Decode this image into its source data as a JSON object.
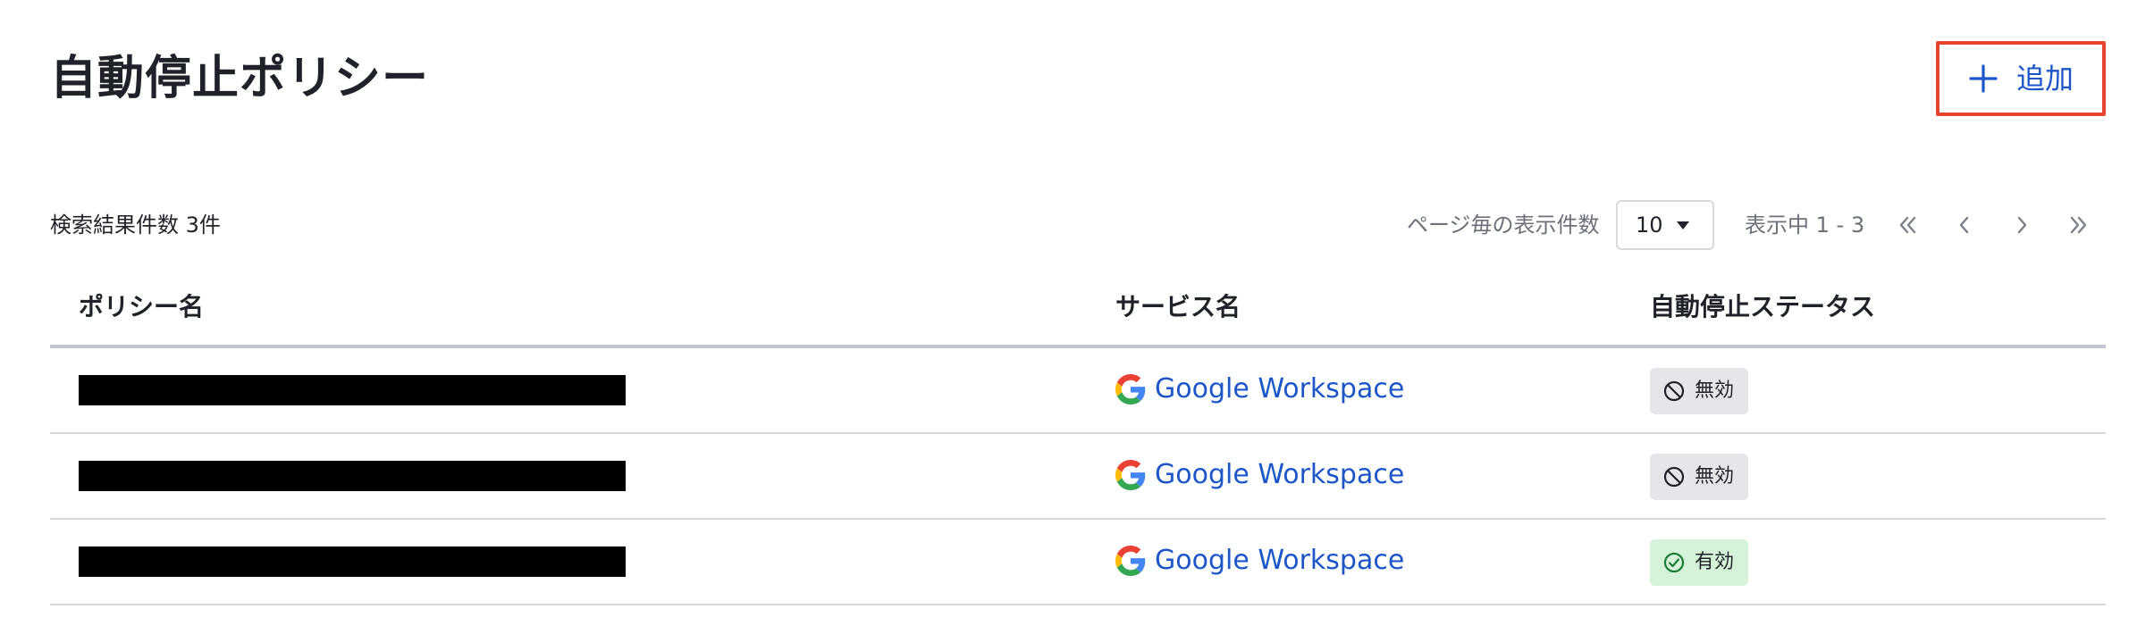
{
  "header": {
    "title": "自動停止ポリシー",
    "add_label": "追加",
    "accent_color": "#1c56c9",
    "highlight_color": "#e5452f"
  },
  "toolbar": {
    "result_count": "検索結果件数 3件",
    "per_page_label": "ページ毎の表示件数",
    "per_page_value": "10",
    "range_text": "表示中 1 - 3"
  },
  "table": {
    "columns": [
      "ポリシー名",
      "サービス名",
      "自動停止ステータス"
    ],
    "rows": [
      {
        "policy_name": "",
        "service": "Google Workspace",
        "status": "無効",
        "status_icon": "block-icon"
      },
      {
        "policy_name": "",
        "service": "Google Workspace",
        "status": "無効",
        "status_icon": "block-icon"
      },
      {
        "policy_name": "",
        "service": "Google Workspace",
        "status": "有効",
        "status_icon": "check-circle-icon"
      }
    ]
  },
  "icons": {
    "add": "plus-icon",
    "first": "double-chevron-left-icon",
    "prev": "chevron-left-icon",
    "next": "chevron-right-icon",
    "last": "double-chevron-right-icon",
    "service": "google-icon"
  }
}
